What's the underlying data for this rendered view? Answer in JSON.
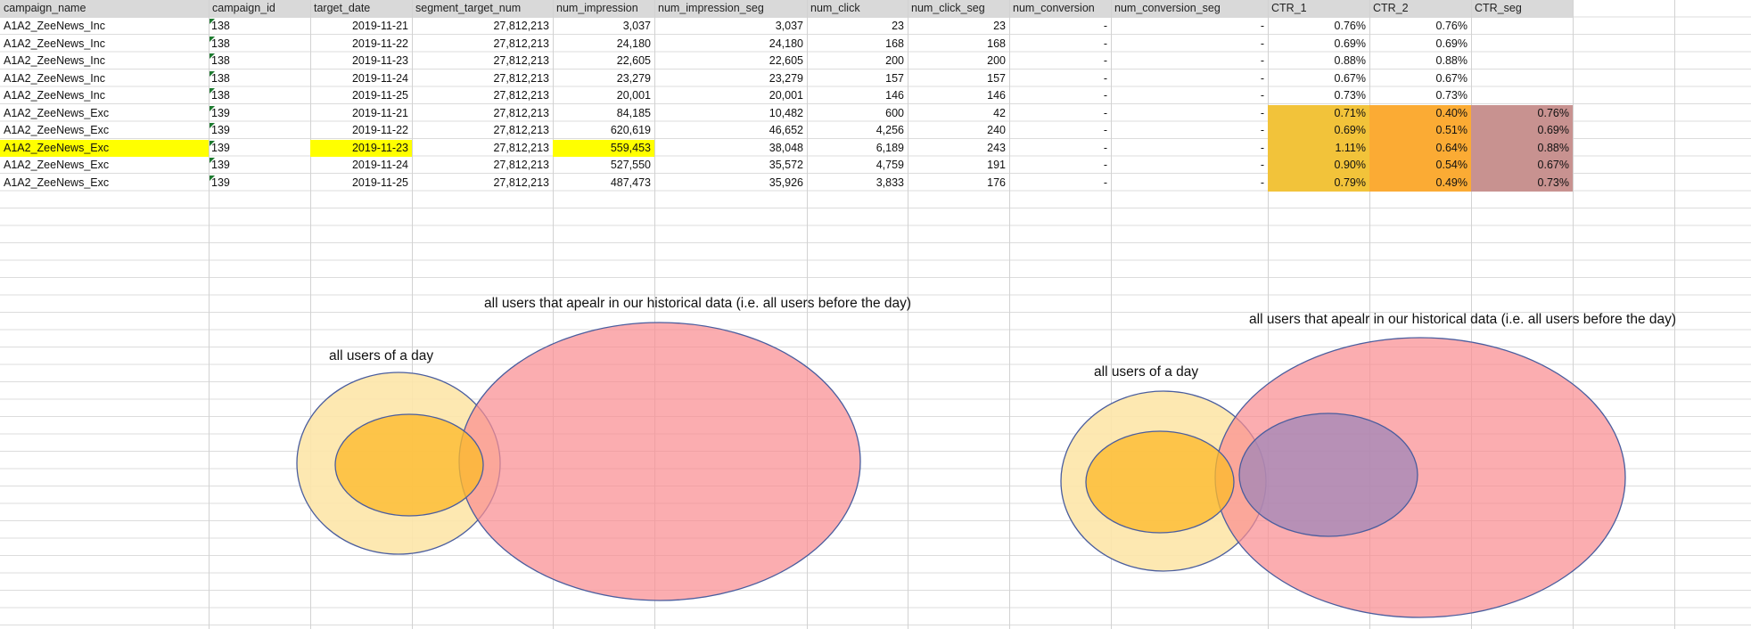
{
  "sheet": {
    "columns": [
      "campaign_name",
      "campaign_id",
      "target_date",
      "segment_target_num",
      "num_impression",
      "num_impression_seg",
      "num_click",
      "num_click_seg",
      "num_conversion",
      "num_conversion_seg",
      "CTR_1",
      "CTR_2",
      "CTR_seg"
    ],
    "rows": [
      {
        "campaign_name": "A1A2_ZeeNews_Inc",
        "campaign_id": "138",
        "target_date": "2019-11-21",
        "segment_target_num": "27,812,213",
        "num_impression": "3,037",
        "num_impression_seg": "3,037",
        "num_click": "23",
        "num_click_seg": "23",
        "num_conversion": "-",
        "num_conversion_seg": "-",
        "CTR_1": "0.76%",
        "CTR_2": "0.76%",
        "CTR_seg": ""
      },
      {
        "campaign_name": "A1A2_ZeeNews_Inc",
        "campaign_id": "138",
        "target_date": "2019-11-22",
        "segment_target_num": "27,812,213",
        "num_impression": "24,180",
        "num_impression_seg": "24,180",
        "num_click": "168",
        "num_click_seg": "168",
        "num_conversion": "-",
        "num_conversion_seg": "-",
        "CTR_1": "0.69%",
        "CTR_2": "0.69%",
        "CTR_seg": ""
      },
      {
        "campaign_name": "A1A2_ZeeNews_Inc",
        "campaign_id": "138",
        "target_date": "2019-11-23",
        "segment_target_num": "27,812,213",
        "num_impression": "22,605",
        "num_impression_seg": "22,605",
        "num_click": "200",
        "num_click_seg": "200",
        "num_conversion": "-",
        "num_conversion_seg": "-",
        "CTR_1": "0.88%",
        "CTR_2": "0.88%",
        "CTR_seg": ""
      },
      {
        "campaign_name": "A1A2_ZeeNews_Inc",
        "campaign_id": "138",
        "target_date": "2019-11-24",
        "segment_target_num": "27,812,213",
        "num_impression": "23,279",
        "num_impression_seg": "23,279",
        "num_click": "157",
        "num_click_seg": "157",
        "num_conversion": "-",
        "num_conversion_seg": "-",
        "CTR_1": "0.67%",
        "CTR_2": "0.67%",
        "CTR_seg": ""
      },
      {
        "campaign_name": "A1A2_ZeeNews_Inc",
        "campaign_id": "138",
        "target_date": "2019-11-25",
        "segment_target_num": "27,812,213",
        "num_impression": "20,001",
        "num_impression_seg": "20,001",
        "num_click": "146",
        "num_click_seg": "146",
        "num_conversion": "-",
        "num_conversion_seg": "-",
        "CTR_1": "0.73%",
        "CTR_2": "0.73%",
        "CTR_seg": ""
      },
      {
        "campaign_name": "A1A2_ZeeNews_Exc",
        "campaign_id": "139",
        "target_date": "2019-11-21",
        "segment_target_num": "27,812,213",
        "num_impression": "84,185",
        "num_impression_seg": "10,482",
        "num_click": "600",
        "num_click_seg": "42",
        "num_conversion": "-",
        "num_conversion_seg": "-",
        "CTR_1": "0.71%",
        "CTR_2": "0.40%",
        "CTR_seg": "0.76%"
      },
      {
        "campaign_name": "A1A2_ZeeNews_Exc",
        "campaign_id": "139",
        "target_date": "2019-11-22",
        "segment_target_num": "27,812,213",
        "num_impression": "620,619",
        "num_impression_seg": "46,652",
        "num_click": "4,256",
        "num_click_seg": "240",
        "num_conversion": "-",
        "num_conversion_seg": "-",
        "CTR_1": "0.69%",
        "CTR_2": "0.51%",
        "CTR_seg": "0.69%"
      },
      {
        "campaign_name": "A1A2_ZeeNews_Exc",
        "campaign_id": "139",
        "target_date": "2019-11-23",
        "segment_target_num": "27,812,213",
        "num_impression": "559,453",
        "num_impression_seg": "38,048",
        "num_click": "6,189",
        "num_click_seg": "243",
        "num_conversion": "-",
        "num_conversion_seg": "-",
        "CTR_1": "1.11%",
        "CTR_2": "0.64%",
        "CTR_seg": "0.88%"
      },
      {
        "campaign_name": "A1A2_ZeeNews_Exc",
        "campaign_id": "139",
        "target_date": "2019-11-24",
        "segment_target_num": "27,812,213",
        "num_impression": "527,550",
        "num_impression_seg": "35,572",
        "num_click": "4,759",
        "num_click_seg": "191",
        "num_conversion": "-",
        "num_conversion_seg": "-",
        "CTR_1": "0.90%",
        "CTR_2": "0.54%",
        "CTR_seg": "0.67%"
      },
      {
        "campaign_name": "A1A2_ZeeNews_Exc",
        "campaign_id": "139",
        "target_date": "2019-11-25",
        "segment_target_num": "27,812,213",
        "num_impression": "487,473",
        "num_impression_seg": "35,926",
        "num_click": "3,833",
        "num_click_seg": "176",
        "num_conversion": "-",
        "num_conversion_seg": "-",
        "CTR_1": "0.79%",
        "CTR_2": "0.49%",
        "CTR_seg": "0.73%"
      }
    ],
    "highlighted_row": 7,
    "highlighted_columns": [
      "campaign_name",
      "target_date",
      "num_impression"
    ]
  },
  "colors": {
    "header_bg": "#d9d9d9",
    "highlight_yellow": "#ffff00",
    "ctr1_fill": "#f2c33a",
    "ctr2_fill": "#fbab34",
    "ctrseg_fill": "#c89290",
    "day_ellipse": "#fde6a8",
    "day_inner": "#fdc233",
    "history_ellipse": "#f9a6a8",
    "segment_ellipse": "#c29aac",
    "outline": "#4a5d9e"
  },
  "diagram_left": {
    "day_label": "all users of a day",
    "history_label": "all users that apealr in our historical data (i.e. all users before the day)"
  },
  "diagram_right": {
    "day_label": "all users of a day",
    "history_label": "all users that apealr in our historical data (i.e. all users before the day)"
  }
}
